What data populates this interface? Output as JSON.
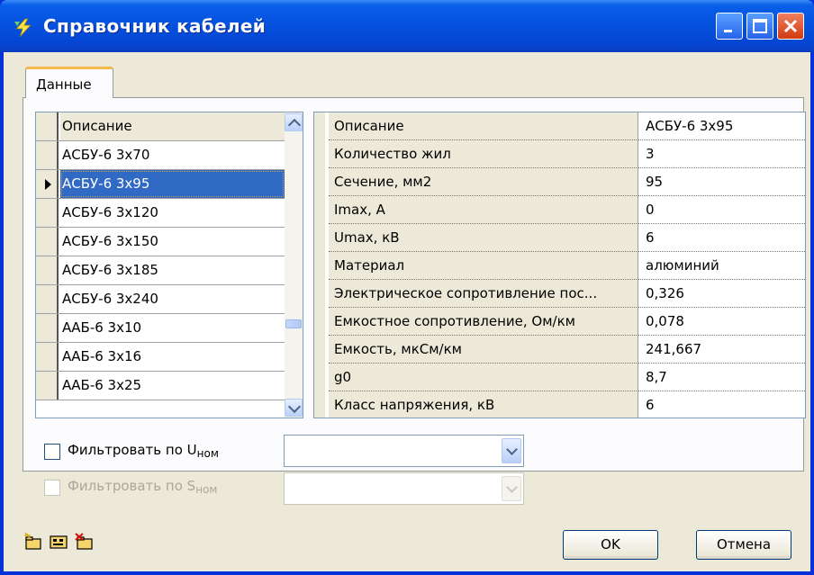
{
  "window": {
    "title": "Справочник кабелей",
    "icon": "lightning-icon",
    "controls": [
      "minimize-icon",
      "maximize-icon",
      "close-icon"
    ]
  },
  "tabs": [
    {
      "label": "Данные",
      "active": true
    }
  ],
  "cable_list": {
    "header": "Описание",
    "items": [
      "АСБУ-6 3х70",
      "АСБУ-6 3х95",
      "АСБУ-6 3х120",
      "АСБУ-6 3х150",
      "АСБУ-6 3х185",
      "АСБУ-6 3х240",
      "ААБ-6 3х10",
      "ААБ-6 3х16",
      "ААБ-6 3х25"
    ],
    "selected": "АСБУ-6 3х95"
  },
  "properties": [
    {
      "name": "Описание",
      "value": "АСБУ-6 3х95"
    },
    {
      "name": "Количество жил",
      "value": "3"
    },
    {
      "name": "Сечение, мм2",
      "value": "95"
    },
    {
      "name": "Imax, А",
      "value": "0"
    },
    {
      "name": "Umax, кВ",
      "value": "6"
    },
    {
      "name": "Материал",
      "value": "алюминий"
    },
    {
      "name": "Электрическое сопротивление пос...",
      "value": "0,326"
    },
    {
      "name": "Емкостное сопротивление, Ом/км",
      "value": "0,078"
    },
    {
      "name": "Емкость, мкСм/км",
      "value": "241,667"
    },
    {
      "name": "g0",
      "value": "8,7"
    },
    {
      "name": "Класс напряжения, кВ",
      "value": "6"
    }
  ],
  "filters": {
    "u": {
      "label": "Фильтровать по U",
      "sub": "ном",
      "checked": false,
      "enabled": true,
      "value": ""
    },
    "s": {
      "label": "Фильтровать по S",
      "sub": "ном",
      "checked": false,
      "enabled": false,
      "value": ""
    }
  },
  "toolbar": {
    "icons": [
      "add-folder-icon",
      "edit-record-icon",
      "delete-folder-icon"
    ]
  },
  "buttons": {
    "ok": "OK",
    "cancel": "Отмена"
  },
  "colors": {
    "titlebar": "#0553e0",
    "selection": "#316ac5",
    "dialog": "#ece9d8"
  }
}
